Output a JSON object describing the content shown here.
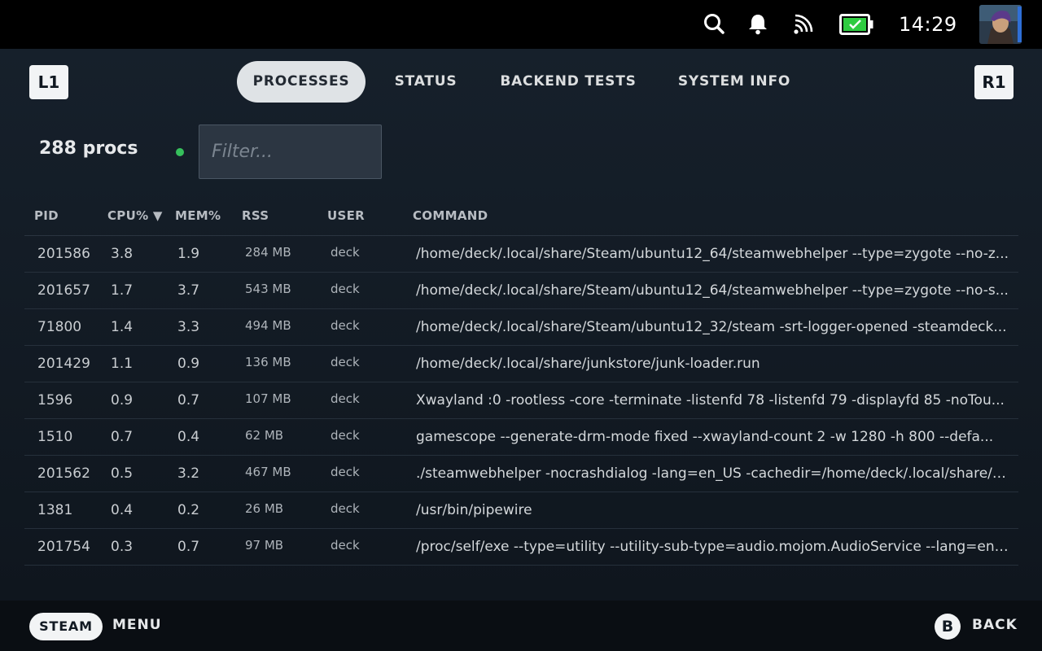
{
  "statusbar": {
    "icons": [
      "search-icon",
      "bell-icon",
      "cast-icon",
      "battery-charging-icon"
    ],
    "battery_color": "#2ecc40",
    "time": "14:29"
  },
  "shoulders": {
    "left": "L1",
    "right": "R1"
  },
  "tabs": [
    {
      "label": "PROCESSES",
      "active": true
    },
    {
      "label": "STATUS",
      "active": false
    },
    {
      "label": "BACKEND TESTS",
      "active": false
    },
    {
      "label": "SYSTEM INFO",
      "active": false
    }
  ],
  "summary": {
    "count_label": "288 procs",
    "status_color": "#36c05c"
  },
  "filter": {
    "placeholder": "Filter...",
    "value": ""
  },
  "table": {
    "columns": [
      "PID",
      "CPU% ▼",
      "MEM%",
      "RSS",
      "USER",
      "COMMAND"
    ],
    "rows": [
      {
        "pid": "201586",
        "cpu": "3.8",
        "mem": "1.9",
        "rss": "284 MB",
        "user": "deck",
        "command": "/home/deck/.local/share/Steam/ubuntu12_64/steamwebhelper --type=zygote --no-z..."
      },
      {
        "pid": "201657",
        "cpu": "1.7",
        "mem": "3.7",
        "rss": "543 MB",
        "user": "deck",
        "command": "/home/deck/.local/share/Steam/ubuntu12_64/steamwebhelper --type=zygote --no-s..."
      },
      {
        "pid": "71800",
        "cpu": "1.4",
        "mem": "3.3",
        "rss": "494 MB",
        "user": "deck",
        "command": "/home/deck/.local/share/Steam/ubuntu12_32/steam -srt-logger-opened -steamdeck..."
      },
      {
        "pid": "201429",
        "cpu": "1.1",
        "mem": "0.9",
        "rss": "136 MB",
        "user": "deck",
        "command": "/home/deck/.local/share/junkstore/junk-loader.run"
      },
      {
        "pid": "1596",
        "cpu": "0.9",
        "mem": "0.7",
        "rss": "107 MB",
        "user": "deck",
        "command": "Xwayland :0 -rootless -core -terminate -listenfd 78 -listenfd 79 -displayfd 85 -noTou..."
      },
      {
        "pid": "1510",
        "cpu": "0.7",
        "mem": "0.4",
        "rss": "62 MB",
        "user": "deck",
        "command": "gamescope --generate-drm-mode fixed --xwayland-count 2 -w 1280 -h 800 --defa..."
      },
      {
        "pid": "201562",
        "cpu": "0.5",
        "mem": "3.2",
        "rss": "467 MB",
        "user": "deck",
        "command": "./steamwebhelper -nocrashdialog -lang=en_US -cachedir=/home/deck/.local/share/S..."
      },
      {
        "pid": "1381",
        "cpu": "0.4",
        "mem": "0.2",
        "rss": "26 MB",
        "user": "deck",
        "command": "/usr/bin/pipewire"
      },
      {
        "pid": "201754",
        "cpu": "0.3",
        "mem": "0.7",
        "rss": "97 MB",
        "user": "deck",
        "command": "/proc/self/exe --type=utility --utility-sub-type=audio.mojom.AudioService --lang=en-..."
      }
    ]
  },
  "footer": {
    "steam_label": "STEAM",
    "menu_label": "MENU",
    "b_label": "B",
    "back_label": "BACK"
  }
}
